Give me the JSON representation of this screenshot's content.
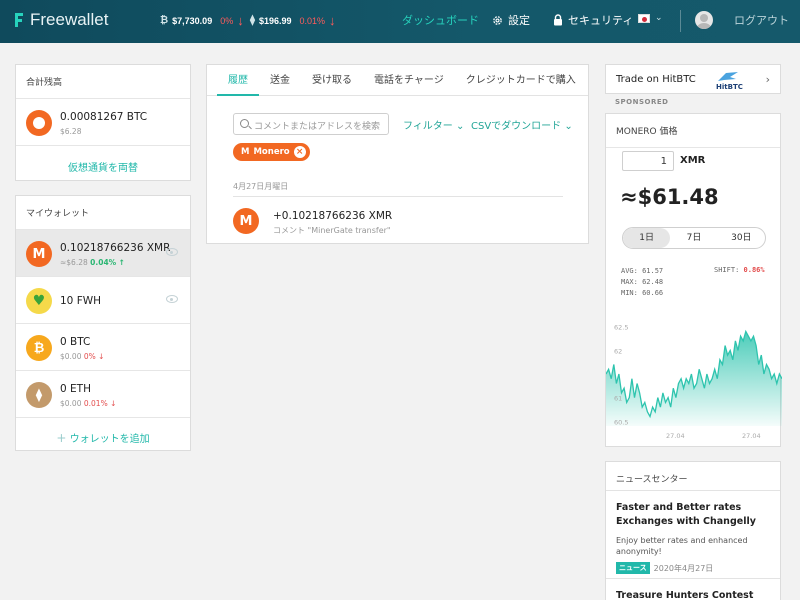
{
  "header": {
    "logo": "Freewallet",
    "tickers": [
      {
        "coin": "₿",
        "price": "$7,730.09",
        "change": "0%",
        "arrow": "↓"
      },
      {
        "coin": "⧫",
        "price": "$196.99",
        "change": "0.01%",
        "arrow": "↓"
      }
    ],
    "nav_dashboard": "ダッシュボード",
    "nav_settings": "設定",
    "nav_security": "セキュリティ",
    "logout": "ログアウト"
  },
  "balance": {
    "title": "合計残高",
    "amount": "0.00081267 BTC",
    "fiat": "$6.28",
    "exchange_link": "仮想通貨を両替"
  },
  "wallets": {
    "title": "マイウォレット",
    "items": [
      {
        "amount": "0.10218766236 XMR",
        "fiat": "≈$6.28",
        "change": "0.04%",
        "arrow": "↑",
        "icon": "monero-icon",
        "color": "#f26822"
      },
      {
        "amount": "10 FWH",
        "fiat": "",
        "change": "",
        "arrow": "",
        "icon": "fwh-heart-icon",
        "color": "#f5d94a"
      },
      {
        "amount": "0 BTC",
        "fiat": "$0.00",
        "change": "0%",
        "arrow": "↓",
        "icon": "bitcoin-icon",
        "color": "#f7a81d"
      },
      {
        "amount": "0 ETH",
        "fiat": "$0.00",
        "change": "0.01%",
        "arrow": "↓",
        "icon": "ethereum-icon",
        "color": "#c39a6b"
      }
    ],
    "add_link": "ウォレットを追加"
  },
  "main": {
    "tabs": [
      "履歴",
      "送金",
      "受け取る",
      "電話をチャージ",
      "クレジットカードで購入"
    ],
    "search_placeholder": "コメントまたはアドレスを検索",
    "filter": "フィルター",
    "csv": "CSVでダウンロード",
    "chip": "Monero",
    "date": "4月27日月曜日",
    "transaction": {
      "amount": "+0.10218766236 XMR",
      "comment": "コメント \"MinerGate transfer\""
    }
  },
  "sidebar": {
    "hitbtc": "Trade on HitBTC",
    "hitbtc_logo": "HitBTC",
    "sponsored": "SPONSORED",
    "price_card": {
      "title": "MONERO 価格",
      "qty": "1",
      "unit": "XMR",
      "price": "≈$61.48",
      "ranges": [
        "1日",
        "7日",
        "30日"
      ],
      "avg": "AVG: 61.57",
      "max": "MAX: 62.48",
      "min": "MIN: 60.66",
      "shift_label": "SHIFT:",
      "shift": "0.86%"
    },
    "news": {
      "title": "ニュースセンター",
      "items": [
        {
          "title": "Faster and Better rates Exchanges with Changelly",
          "desc": "Enjoy better rates and enhanced anonymity!",
          "badge": "ニュース",
          "date": "2020年4月27日"
        },
        {
          "title": "Treasure Hunters Contest"
        }
      ]
    }
  },
  "chart_data": {
    "type": "area",
    "yticks": [
      "62.5",
      "62",
      "61",
      "60.5"
    ],
    "xticks": [
      "27.04",
      "27.04"
    ],
    "ylim": [
      60.4,
      62.6
    ],
    "values": [
      61.5,
      61.6,
      61.4,
      61.7,
      61.3,
      61.5,
      61.1,
      61.2,
      60.9,
      61.0,
      61.4,
      61.0,
      61.3,
      61.1,
      60.8,
      60.9,
      60.7,
      60.6,
      60.8,
      60.7,
      61.0,
      60.8,
      61.1,
      60.9,
      61.0,
      60.8,
      61.2,
      61.0,
      61.3,
      61.4,
      61.2,
      61.4,
      61.3,
      61.5,
      61.2,
      61.3,
      61.6,
      61.4,
      61.2,
      61.5,
      61.3,
      61.4,
      61.6,
      61.4,
      61.8,
      61.7,
      62.1,
      61.9,
      62.0,
      61.8,
      62.2,
      62.0,
      62.3,
      62.2,
      62.4,
      62.3,
      62.2,
      62.3,
      62.1,
      61.7,
      61.9,
      61.5,
      61.7,
      61.6,
      61.4,
      61.5,
      61.3,
      61.5,
      61.4
    ],
    "color": "#2ec4ae"
  }
}
